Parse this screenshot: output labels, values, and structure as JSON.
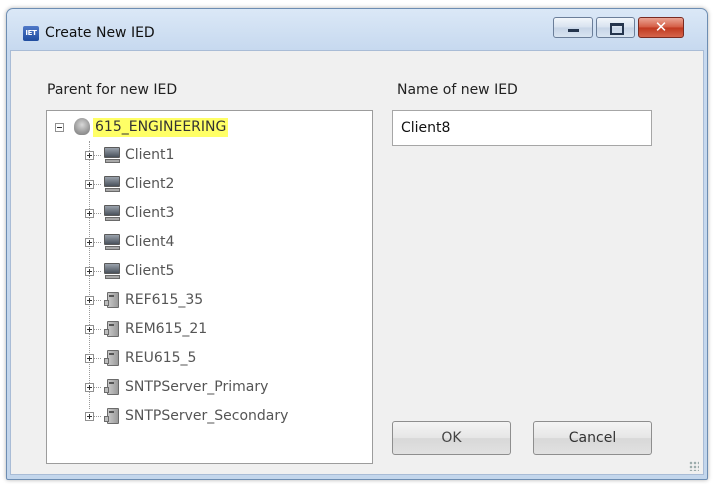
{
  "window": {
    "title": "Create New IED",
    "app_icon_text": "IET"
  },
  "controls": {
    "minimize": "minimize",
    "maximize": "maximize",
    "close": "✕"
  },
  "labels": {
    "parent": "Parent for new IED",
    "name": "Name of new IED"
  },
  "tree": {
    "root": "615_ENGINEERING",
    "items": [
      {
        "label": "Client1",
        "type": "computer"
      },
      {
        "label": "Client2",
        "type": "computer"
      },
      {
        "label": "Client3",
        "type": "computer"
      },
      {
        "label": "Client4",
        "type": "computer"
      },
      {
        "label": "Client5",
        "type": "computer"
      },
      {
        "label": "REF615_35",
        "type": "ied"
      },
      {
        "label": "REM615_21",
        "type": "ied"
      },
      {
        "label": "REU615_5",
        "type": "ied"
      },
      {
        "label": "SNTPServer_Primary",
        "type": "ied"
      },
      {
        "label": "SNTPServer_Secondary",
        "type": "ied"
      }
    ]
  },
  "name_input": {
    "value": "Client8"
  },
  "buttons": {
    "ok": "OK",
    "cancel": "Cancel"
  },
  "colors": {
    "selection_highlight": "#ffff66",
    "close_button": "#c0381f"
  }
}
